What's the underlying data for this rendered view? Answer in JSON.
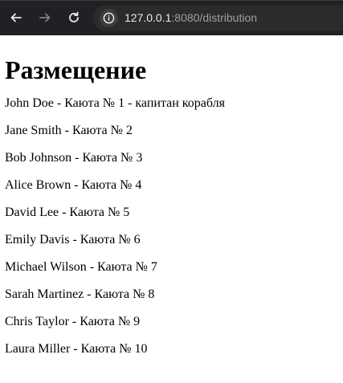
{
  "browser": {
    "url_host": "127.0.0.1",
    "url_rest": ":8080/distribution",
    "icons": {
      "back": "back-arrow-icon",
      "forward": "forward-arrow-icon",
      "reload": "reload-icon",
      "site_info": "info-icon"
    },
    "colors": {
      "toolbar": "#202124",
      "omnibox": "#2b2b2b"
    }
  },
  "page": {
    "title": "Размещение",
    "assignments": [
      "John Doe - Каюта № 1 - капитан корабля",
      "Jane Smith - Каюта № 2",
      "Bob Johnson - Каюта № 3",
      "Alice Brown - Каюта № 4",
      "David Lee - Каюта № 5",
      "Emily Davis - Каюта № 6",
      "Michael Wilson - Каюта № 7",
      "Sarah Martinez - Каюта № 8",
      "Chris Taylor - Каюта № 9",
      "Laura Miller - Каюта № 10"
    ]
  }
}
